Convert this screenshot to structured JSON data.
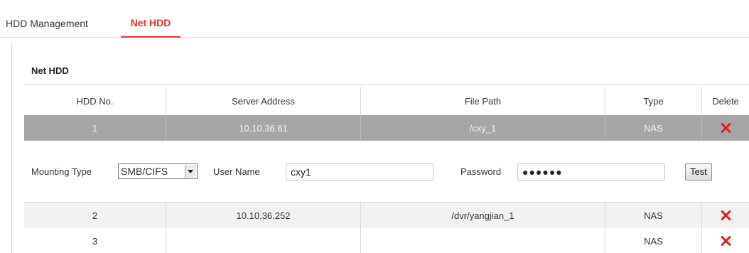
{
  "tabs": [
    {
      "label": "HDD Management",
      "active": false
    },
    {
      "label": "Net HDD",
      "active": true
    }
  ],
  "section": {
    "title": "Net HDD"
  },
  "table": {
    "headers": [
      "HDD No.",
      "Server Address",
      "File Path",
      "Type",
      "Delete"
    ],
    "rows": [
      {
        "no": "1",
        "server": "10.10.36.61",
        "path": "/cxy_1",
        "type": "NAS",
        "selected": true
      },
      {
        "no": "2",
        "server": "10.10.36.252",
        "path": "/dvr/yangjian_1",
        "type": "NAS",
        "selected": false
      },
      {
        "no": "3",
        "server": "",
        "path": "",
        "type": "NAS",
        "selected": false
      }
    ]
  },
  "edit": {
    "mounting_type_label": "Mounting Type",
    "mounting_type_value": "SMB/CIFS",
    "user_name_label": "User Name",
    "user_name_value": "cxy1",
    "password_label": "Password",
    "password_value": "●●●●●●",
    "test_label": "Test"
  },
  "colors": {
    "accent": "#e8322e",
    "selected_row": "#a6a6a6",
    "delete_icon": "#e02020"
  },
  "icons": {
    "delete": "close-x-icon",
    "select": "chevron-down-icon"
  }
}
